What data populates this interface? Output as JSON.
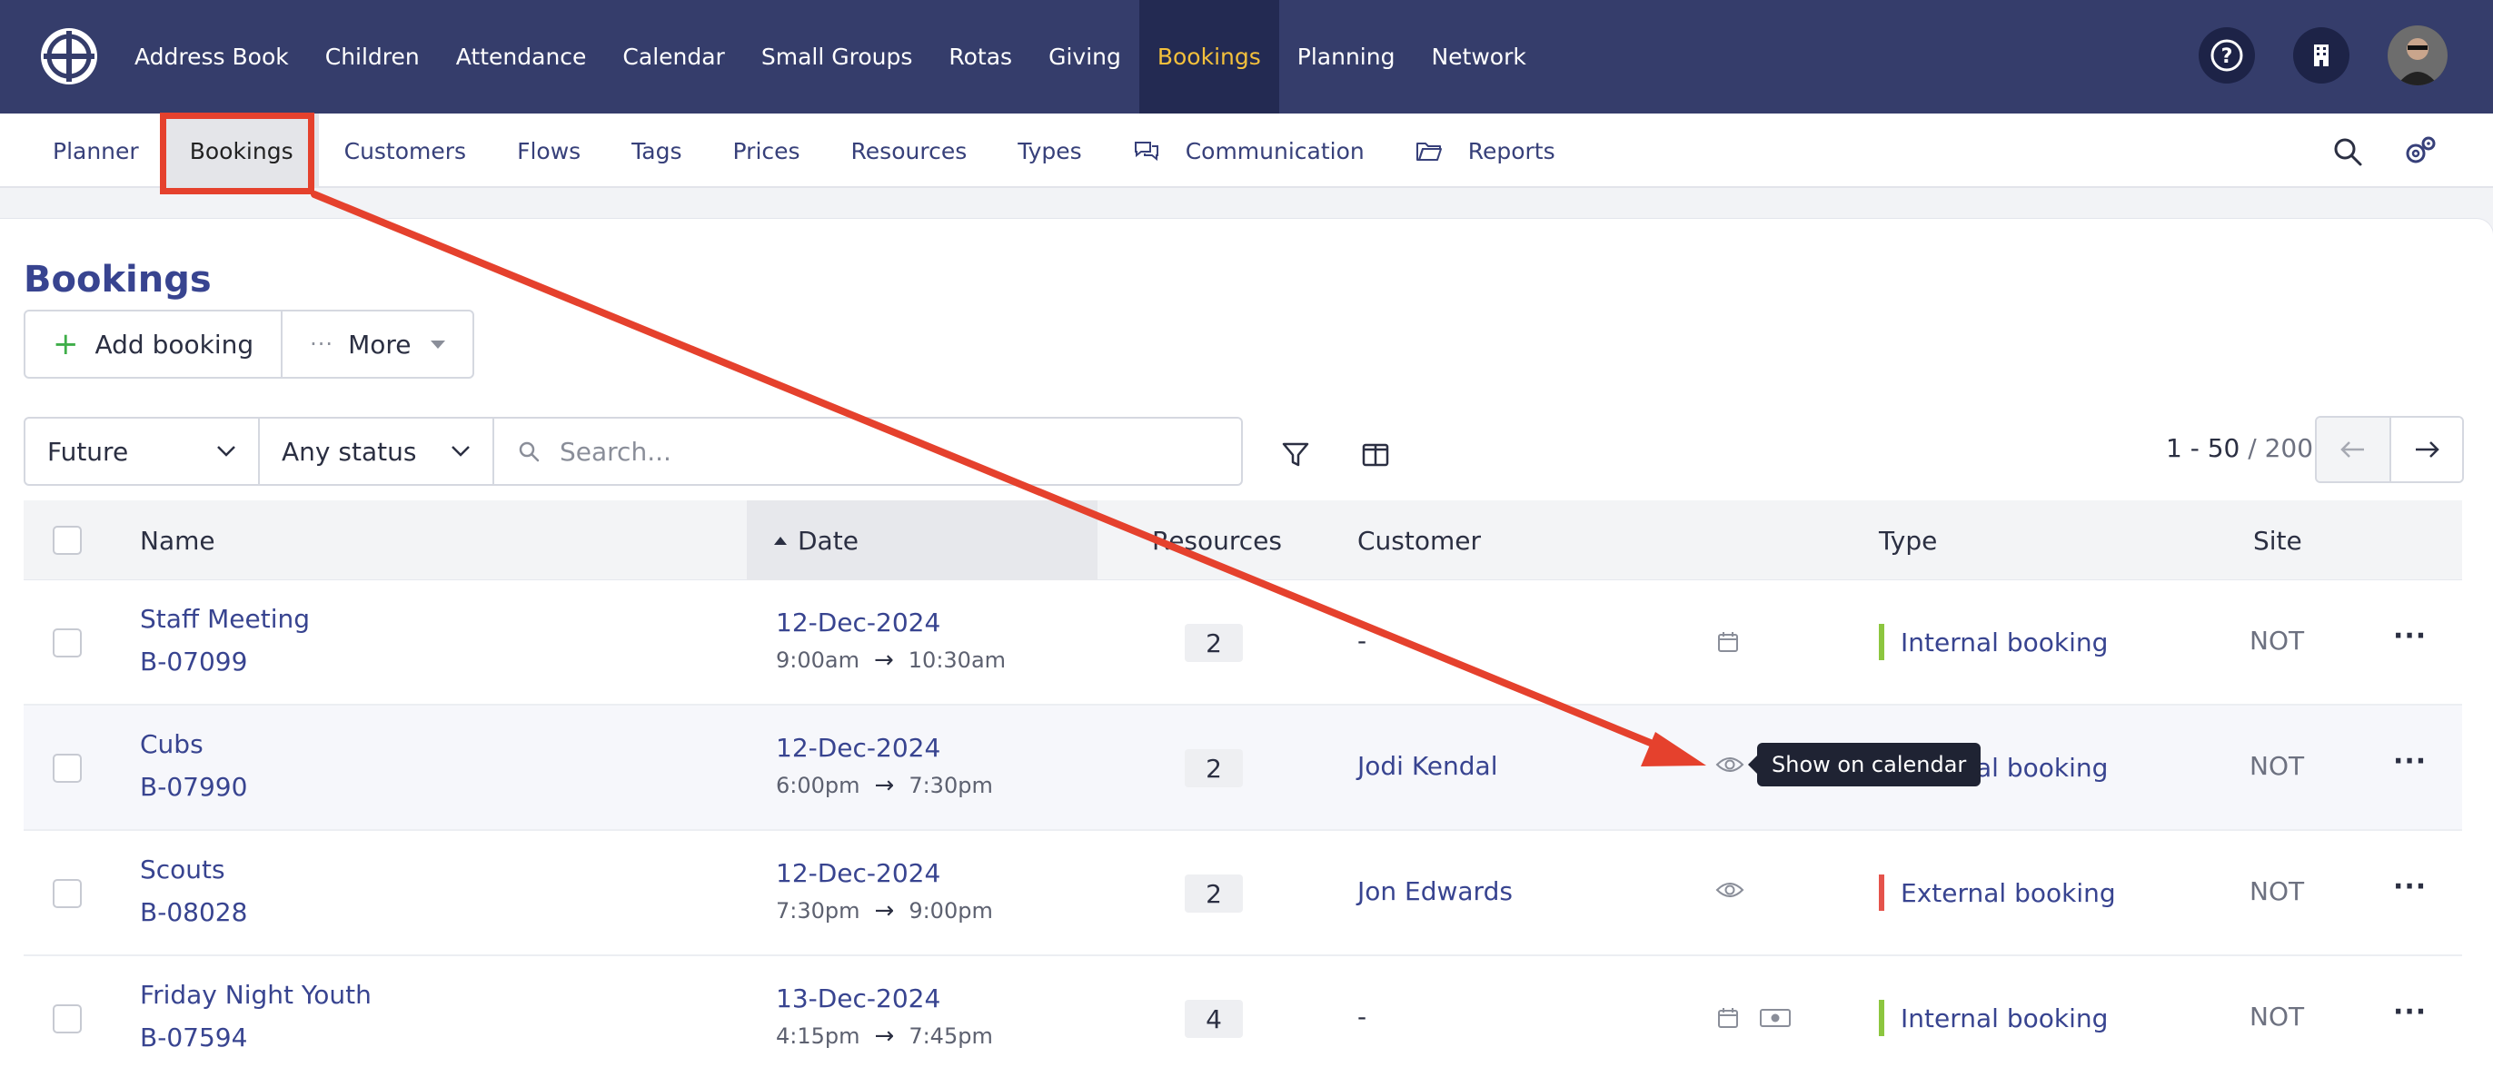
{
  "topnav": {
    "items": [
      {
        "label": "Address Book"
      },
      {
        "label": "Children"
      },
      {
        "label": "Attendance"
      },
      {
        "label": "Calendar"
      },
      {
        "label": "Small Groups"
      },
      {
        "label": "Rotas"
      },
      {
        "label": "Giving"
      },
      {
        "label": "Bookings",
        "active": true
      },
      {
        "label": "Planning"
      },
      {
        "label": "Network"
      }
    ],
    "right_icons": [
      "help-icon",
      "building-icon",
      "user-avatar"
    ]
  },
  "subnav": {
    "items": [
      {
        "label": "Planner"
      },
      {
        "label": "Bookings",
        "active": true
      },
      {
        "label": "Customers"
      },
      {
        "label": "Flows"
      },
      {
        "label": "Tags"
      },
      {
        "label": "Prices"
      },
      {
        "label": "Resources"
      },
      {
        "label": "Types"
      },
      {
        "label": "Communication",
        "icon": "chat-icon"
      },
      {
        "label": "Reports",
        "icon": "folder-icon"
      }
    ],
    "right_icons": [
      "search-icon",
      "settings-icon"
    ]
  },
  "page": {
    "title": "Bookings",
    "add_label": "Add booking",
    "more_label": "More"
  },
  "filters": {
    "period": "Future",
    "status": "Any status",
    "search_placeholder": "Search..."
  },
  "pagination": {
    "range": "1 - 50",
    "separator": " / ",
    "total": "200"
  },
  "table": {
    "headers": {
      "name": "Name",
      "date": "Date",
      "resources": "Resources",
      "customer": "Customer",
      "type": "Type",
      "site": "Site"
    },
    "sort_column": "Date",
    "rows": [
      {
        "name": "Staff Meeting",
        "code": "B-07099",
        "date": "12-Dec-2024",
        "start": "9:00am",
        "end": "10:30am",
        "resources": "2",
        "customer": "-",
        "icons": [
          "calendar-icon"
        ],
        "type": "Internal booking",
        "type_color": "#8cc63f",
        "site": "NOT"
      },
      {
        "name": "Cubs",
        "code": "B-07990",
        "date": "12-Dec-2024",
        "start": "6:00pm",
        "end": "7:30pm",
        "resources": "2",
        "customer": "Jodi Kendal",
        "icons": [
          "eye-icon"
        ],
        "type": "Internal booking",
        "type_color": "#8cc63f",
        "site": "NOT"
      },
      {
        "name": "Scouts",
        "code": "B-08028",
        "date": "12-Dec-2024",
        "start": "7:30pm",
        "end": "9:00pm",
        "resources": "2",
        "customer": "Jon Edwards",
        "icons": [
          "eye-icon"
        ],
        "type": "External booking",
        "type_color": "#e5534b",
        "site": "NOT"
      },
      {
        "name": "Friday Night Youth",
        "code": "B-07594",
        "date": "13-Dec-2024",
        "start": "4:15pm",
        "end": "7:45pm",
        "resources": "4",
        "customer": "-",
        "icons": [
          "calendar-icon",
          "money-icon"
        ],
        "type": "Internal booking",
        "type_color": "#8cc63f",
        "site": "NOT"
      }
    ]
  },
  "tooltip": {
    "text": "Show on calendar"
  },
  "colors": {
    "nav_bg": "#353d6b",
    "nav_active": "#f3c03c",
    "link": "#384490",
    "annotation": "#e5412d"
  }
}
